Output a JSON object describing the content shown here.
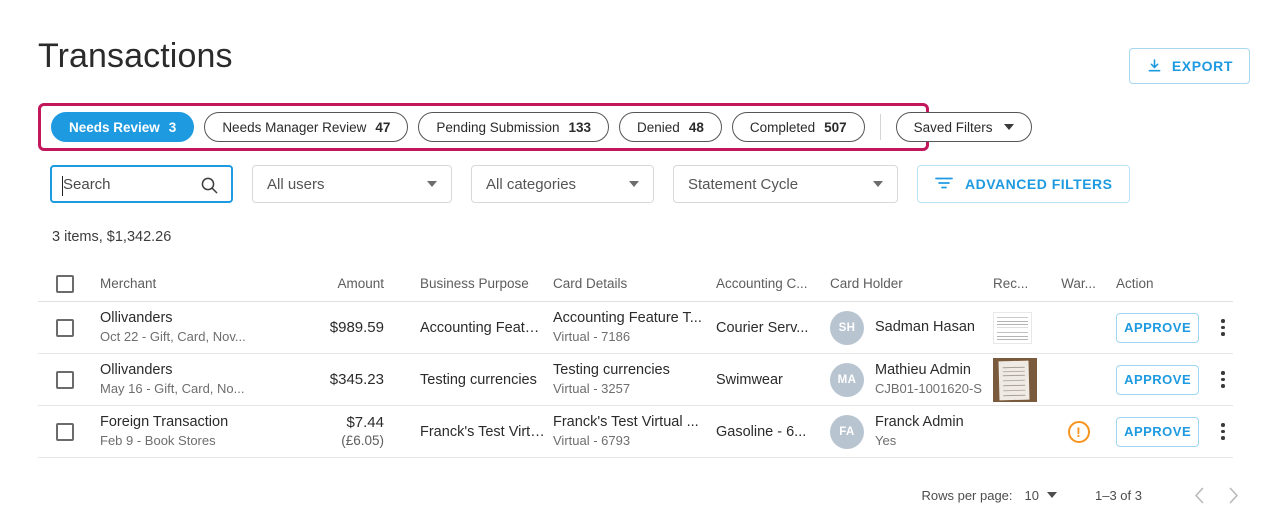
{
  "header": {
    "title": "Transactions",
    "export_label": "EXPORT",
    "export_icon": "download-icon"
  },
  "status_chips": [
    {
      "label": "Needs Review",
      "count": "3",
      "active": true
    },
    {
      "label": "Needs Manager Review",
      "count": "47",
      "active": false
    },
    {
      "label": "Pending Submission",
      "count": "133",
      "active": false
    },
    {
      "label": "Denied",
      "count": "48",
      "active": false
    },
    {
      "label": "Completed",
      "count": "507",
      "active": false
    }
  ],
  "saved_filters": {
    "label": "Saved Filters",
    "caret_icon": "chevron-down-icon"
  },
  "filters": {
    "search": {
      "placeholder": "Search",
      "value": "",
      "icon": "search-icon"
    },
    "users_select": {
      "value": "All users"
    },
    "categories_select": {
      "value": "All categories"
    },
    "cycle_select": {
      "value": "Statement Cycle"
    },
    "advanced": {
      "label": "ADVANCED FILTERS",
      "icon": "filter-icon"
    }
  },
  "summary": "3 items, $1,342.26",
  "table": {
    "columns": [
      "Merchant",
      "Amount",
      "Business Purpose",
      "Card Details",
      "Accounting C...",
      "Card Holder",
      "Rec...",
      "War...",
      "Action"
    ],
    "rows": [
      {
        "merchant": "Ollivanders",
        "merchant_sub": "Oct 22 - Gift, Card, Nov...",
        "amount": "$989.59",
        "amount_sub": "",
        "business_purpose": "Accounting Feature T...",
        "card_details": "Accounting Feature T...",
        "card_details_sub": "Virtual - 7186",
        "accounting_code": "Courier Serv...",
        "holder_initials": "SH",
        "holder_name": "Sadman Hasan",
        "holder_sub": "",
        "receipt": "receipt-scan",
        "warning": false,
        "action_label": "APPROVE"
      },
      {
        "merchant": "Ollivanders",
        "merchant_sub": "May 16 - Gift, Card, No...",
        "amount": "$345.23",
        "amount_sub": "",
        "business_purpose": "Testing currencies",
        "card_details": "Testing currencies",
        "card_details_sub": "Virtual - 3257",
        "accounting_code": "Swimwear",
        "holder_initials": "MA",
        "holder_name": "Mathieu Admin",
        "holder_sub": "CJB01-1001620-S",
        "receipt": "receipt-photo",
        "warning": false,
        "action_label": "APPROVE"
      },
      {
        "merchant": "Foreign Transaction",
        "merchant_sub": "Feb 9 - Book Stores",
        "amount": "$7.44",
        "amount_sub": "(£6.05)",
        "business_purpose": "Franck's Test Virtual ...",
        "card_details": "Franck's Test Virtual ...",
        "card_details_sub": "Virtual - 6793",
        "accounting_code": "Gasoline - 6...",
        "holder_initials": "FA",
        "holder_name": "Franck Admin",
        "holder_sub": "Yes",
        "receipt": "",
        "warning": true,
        "action_label": "APPROVE"
      }
    ]
  },
  "pagination": {
    "rows_per_page_label": "Rows per page:",
    "rows_per_page_value": "10",
    "range": "1–3 of 3",
    "prev_icon": "chevron-left-icon",
    "next_icon": "chevron-right-icon"
  },
  "colors": {
    "accent_blue": "#1e9ae0",
    "highlight_pink": "#c2185b",
    "warning_orange": "#f7941e",
    "avatar_gray": "#b8c4d0"
  }
}
